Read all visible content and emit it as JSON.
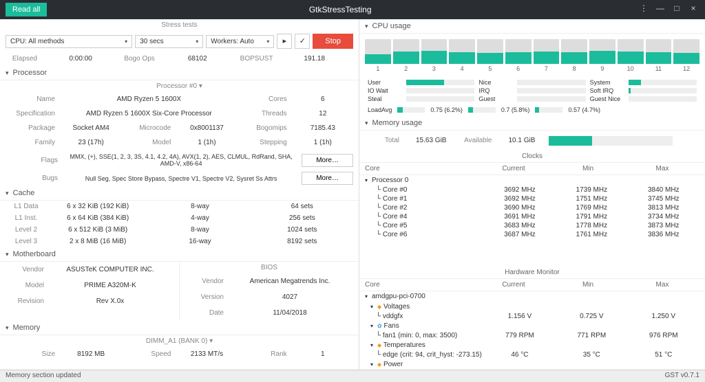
{
  "titlebar": {
    "read_all": "Read all",
    "title": "GtkStressTesting"
  },
  "stress": {
    "title": "Stress tests",
    "method": "CPU: All methods",
    "duration": "30 secs",
    "workers": "Workers: Auto",
    "stop": "Stop",
    "elapsed_lbl": "Elapsed",
    "elapsed": "0:00:00",
    "bogo_lbl": "Bogo Ops",
    "bogo": "68102",
    "bopsust_lbl": "BOPSUST",
    "bopsust": "191.18"
  },
  "proc": {
    "header": "Processor",
    "sub": "Processor #0  ▾",
    "name_lbl": "Name",
    "name": "AMD Ryzen 5 1600X",
    "cores_lbl": "Cores",
    "cores": "6",
    "spec_lbl": "Specification",
    "spec": "AMD Ryzen 5 1600X Six-Core Processor",
    "threads_lbl": "Threads",
    "threads": "12",
    "pkg_lbl": "Package",
    "pkg": "Socket AM4",
    "micro_lbl": "Microcode",
    "micro": "0x8001137",
    "bogomips_lbl": "Bogomips",
    "bogomips": "7185.43",
    "family_lbl": "Family",
    "family": "23 (17h)",
    "model_lbl": "Model",
    "model": "1 (1h)",
    "step_lbl": "Stepping",
    "step": "1 (1h)",
    "flags_lbl": "Flags",
    "flags": "MMX, (+), SSE(1, 2, 3, 3S, 4.1, 4.2, 4A), AVX(1, 2), AES, CLMUL, RdRand, SHA, AMD-V, x86-64",
    "bugs_lbl": "Bugs",
    "bugs": "Null Seg, Spec Store Bypass, Spectre V1, Spectre V2, Sysret Ss Attrs",
    "more": "More…"
  },
  "cache": {
    "header": "Cache",
    "rows": [
      [
        "L1 Data",
        "6 x 32 KiB (192 KiB)",
        "8-way",
        "64 sets"
      ],
      [
        "L1 Inst.",
        "6 x 64 KiB (384 KiB)",
        "4-way",
        "256 sets"
      ],
      [
        "Level 2",
        "6 x 512 KiB (3 MiB)",
        "8-way",
        "1024 sets"
      ],
      [
        "Level 3",
        "2 x 8 MiB (16 MiB)",
        "16-way",
        "8192 sets"
      ]
    ]
  },
  "mb": {
    "header": "Motherboard",
    "bios_title": "BIOS",
    "vendor_lbl": "Vendor",
    "vendor": "ASUSTeK COMPUTER INC.",
    "model_lbl": "Model",
    "model": "PRIME A320M-K",
    "rev_lbl": "Revision",
    "rev": "Rev X.0x",
    "bvendor_lbl": "Vendor",
    "bvendor": "American Megatrends Inc.",
    "bver_lbl": "Version",
    "bver": "4027",
    "bdate_lbl": "Date",
    "bdate": "11/04/2018"
  },
  "mem": {
    "header": "Memory",
    "dimm": "DIMM_A1 (BANK 0)  ▾",
    "size_lbl": "Size",
    "size": "8192 MB",
    "speed_lbl": "Speed",
    "speed": "2133 MT/s",
    "rank_lbl": "Rank",
    "rank": "1"
  },
  "cpu_usage": {
    "header": "CPU usage",
    "bars": [
      40,
      50,
      52,
      48,
      44,
      46,
      50,
      48,
      52,
      50,
      46,
      44
    ],
    "labels": [
      "1",
      "2",
      "3",
      "4",
      "5",
      "6",
      "7",
      "8",
      "9",
      "10",
      "11",
      "12"
    ],
    "stats": {
      "user_lbl": "User",
      "user": 55,
      "nice_lbl": "Nice",
      "nice": 0,
      "system_lbl": "System",
      "system": 18,
      "iowait_lbl": "IO Wait",
      "iowait": 0,
      "irq_lbl": "IRQ",
      "irq": 0,
      "softirq_lbl": "Soft IRQ",
      "softirq": 3,
      "steal_lbl": "Steal",
      "steal": 0,
      "guest_lbl": "Guest",
      "guest": 0,
      "guestnice_lbl": "Guest Nice",
      "guestnice": 0
    },
    "loadavg_lbl": "LoadAvg",
    "load1": "0.75 (6.2%)",
    "load5": "0.7 (5.8%)",
    "load15": "0.57 (4.7%)"
  },
  "memusage": {
    "header": "Memory usage",
    "total_lbl": "Total",
    "total": "15.63 GiB",
    "avail_lbl": "Available",
    "avail": "10.1 GiB",
    "pct": 35
  },
  "clocks": {
    "title": "Clocks",
    "hdr": [
      "Core",
      "Current",
      "Min",
      "Max"
    ],
    "proc_lbl": "Processor 0",
    "rows": [
      [
        "Core #0",
        "3692 MHz",
        "1739 MHz",
        "3840 MHz"
      ],
      [
        "Core #1",
        "3692 MHz",
        "1751 MHz",
        "3745 MHz"
      ],
      [
        "Core #2",
        "3690 MHz",
        "1769 MHz",
        "3813 MHz"
      ],
      [
        "Core #4",
        "3691 MHz",
        "1791 MHz",
        "3734 MHz"
      ],
      [
        "Core #5",
        "3683 MHz",
        "1778 MHz",
        "3873 MHz"
      ],
      [
        "Core #6",
        "3687 MHz",
        "1761 MHz",
        "3836 MHz"
      ]
    ]
  },
  "hwmon": {
    "title": "Hardware Monitor",
    "hdr": [
      "Core",
      "Current",
      "Min",
      "Max"
    ],
    "dev": "amdgpu-pci-0700",
    "volt_lbl": "Voltages",
    "vddgfx": [
      "vddgfx",
      "1.156 V",
      "0.725 V",
      "1.250 V"
    ],
    "fans_lbl": "Fans",
    "fan1": [
      "fan1 (min: 0, max: 3500)",
      "779 RPM",
      "771 RPM",
      "976 RPM"
    ],
    "temp_lbl": "Temperatures",
    "edge": [
      "edge (crit: 94, crit_hyst: -273.15)",
      "46 °C",
      "35 °C",
      "51 °C"
    ],
    "power_lbl": "Power"
  },
  "status": {
    "left": "Memory section updated",
    "right": "GST v0.7.1"
  }
}
